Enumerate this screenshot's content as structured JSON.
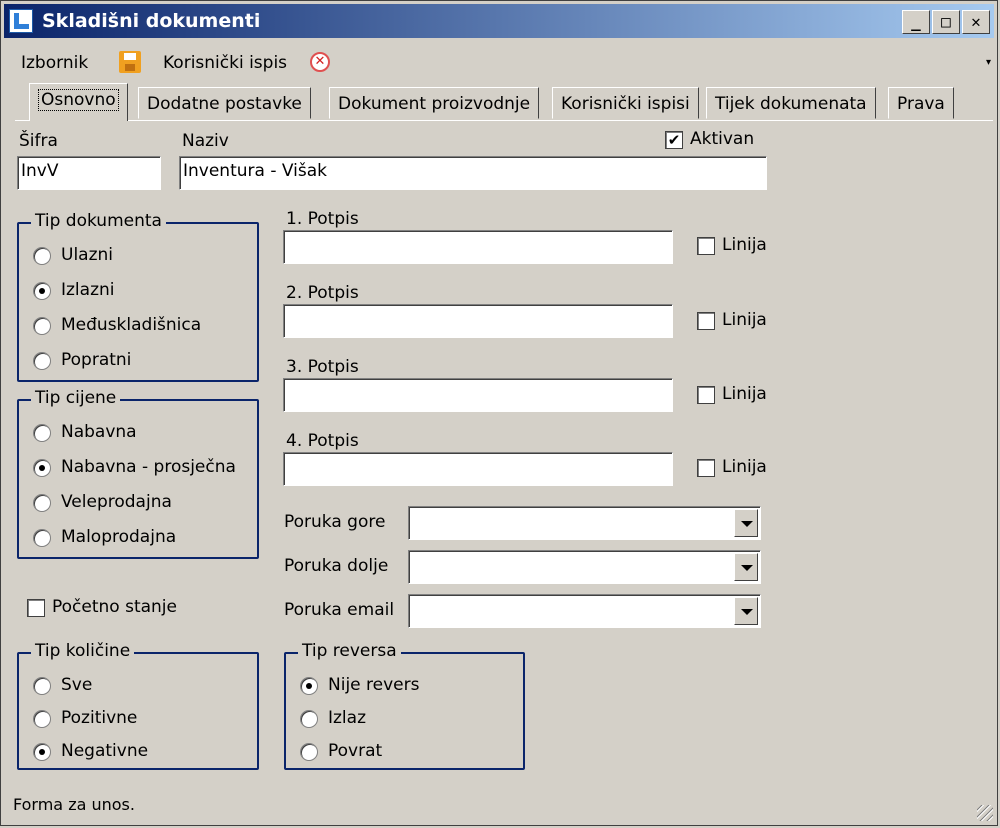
{
  "window": {
    "title": "Skladišni dokumenti"
  },
  "titlebar_buttons": {
    "minimize": "_",
    "maximize": "□",
    "close": "✕"
  },
  "menu": {
    "izbornik": "Izbornik",
    "korisnicki_ispis": "Korisnički ispis",
    "overflow": "▾"
  },
  "tabs": [
    "Osnovno",
    "Dodatne postavke",
    "Dokument proizvodnje",
    "Korisnički ispisi",
    "Tijek dokumenata",
    "Prava"
  ],
  "form": {
    "sifra_label": "Šifra",
    "sifra_value": "InvV",
    "naziv_label": "Naziv",
    "naziv_value": "Inventura - Višak",
    "aktivan_label": "Aktivan",
    "aktivan_checked": true,
    "aktivan_mark": "✔"
  },
  "tip_dokumenta": {
    "title": "Tip dokumenta",
    "options": [
      "Ulazni",
      "Izlazni",
      "Međuskladišnica",
      "Popratni"
    ],
    "selected": "Izlazni"
  },
  "tip_cijene": {
    "title": "Tip cijene",
    "options": [
      "Nabavna",
      "Nabavna - prosječna",
      "Veleprodajna",
      "Maloprodajna"
    ],
    "selected": "Nabavna - prosječna"
  },
  "pocetno_stanje": {
    "label": "Početno stanje",
    "checked": false
  },
  "tip_kolicine": {
    "title": "Tip količine",
    "options": [
      "Sve",
      "Pozitivne",
      "Negativne"
    ],
    "selected": "Negativne"
  },
  "tip_reversa": {
    "title": "Tip reversa",
    "options": [
      "Nije revers",
      "Izlaz",
      "Povrat"
    ],
    "selected": "Nije revers"
  },
  "potpisi": [
    {
      "label": "1. Potpis",
      "value": "",
      "linija_label": "Linija",
      "linija_checked": false
    },
    {
      "label": "2. Potpis",
      "value": "",
      "linija_label": "Linija",
      "linija_checked": false
    },
    {
      "label": "3. Potpis",
      "value": "",
      "linija_label": "Linija",
      "linija_checked": false
    },
    {
      "label": "4. Potpis",
      "value": "",
      "linija_label": "Linija",
      "linija_checked": false
    }
  ],
  "poruke": [
    {
      "label": "Poruka gore",
      "value": ""
    },
    {
      "label": "Poruka dolje",
      "value": ""
    },
    {
      "label": "Poruka email",
      "value": ""
    }
  ],
  "status": {
    "text": "Forma za unos."
  },
  "colors": {
    "title_gradient_start": "#0a246a",
    "title_gradient_end": "#a6caf0",
    "group_border": "#0a246a",
    "window_bg": "#d4d0c8"
  }
}
